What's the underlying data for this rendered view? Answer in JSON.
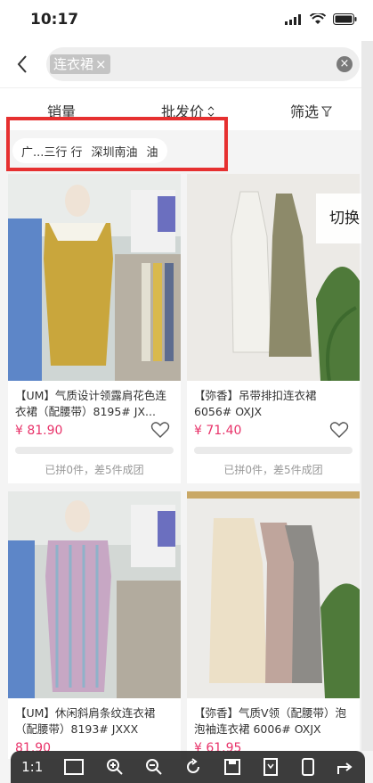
{
  "status_bar": {
    "time": "10:17"
  },
  "search": {
    "query": "连衣裙",
    "chip_close": "×",
    "clear": "×"
  },
  "sort": {
    "sales": "销量",
    "price": "批发价",
    "filter": "筛选"
  },
  "tags": {
    "first": "广...三行 行",
    "second": "深圳南油",
    "third": "油"
  },
  "switch_label": "切换",
  "products": [
    {
      "title": "【UM】气质设计领露肩花色连衣裙（配腰带）8195# JX...",
      "price": "¥ 81.90",
      "group": "已拼0件，差5件成团"
    },
    {
      "title": "【弥香】吊带排扣连衣裙 6056# OXJX",
      "price": "¥ 71.40",
      "group": "已拼0件，差5件成团"
    },
    {
      "title": "【UM】休闲斜肩条纹连衣裙（配腰带）8193# JXXX",
      "price": "81.90",
      "group": ""
    },
    {
      "title": "【弥香】气质V领（配腰带）泡泡袖连衣裙 6006# OXJX",
      "price": "¥ 61.95",
      "group": ""
    }
  ],
  "toolbar": {
    "ratio": "1:1"
  },
  "colors": {
    "accent_price": "#e8336a",
    "highlight_border": "#e63030"
  }
}
